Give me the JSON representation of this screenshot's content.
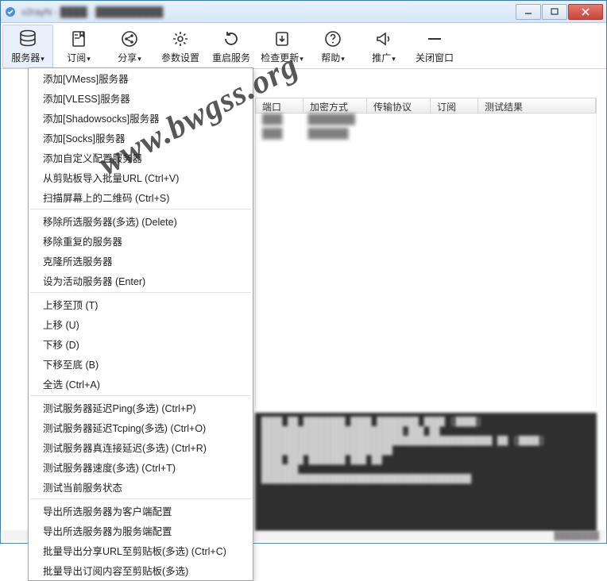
{
  "window": {
    "title_prefix": "v2rayN - ",
    "title_blur": "████ · ██████████"
  },
  "toolbar": {
    "items": [
      {
        "label": "服务器",
        "icon": "server-icon",
        "dropdown": true
      },
      {
        "label": "订阅",
        "icon": "subscribe-icon",
        "dropdown": true
      },
      {
        "label": "分享",
        "icon": "share-icon",
        "dropdown": true
      },
      {
        "label": "参数设置",
        "icon": "settings-icon",
        "dropdown": false
      },
      {
        "label": "重启服务",
        "icon": "restart-icon",
        "dropdown": false
      },
      {
        "label": "检查更新",
        "icon": "update-icon",
        "dropdown": true
      },
      {
        "label": "帮助",
        "icon": "help-icon",
        "dropdown": true
      },
      {
        "label": "推广",
        "icon": "promo-icon",
        "dropdown": true
      },
      {
        "label": "关闭窗口",
        "icon": "close-icon",
        "dropdown": false
      }
    ]
  },
  "menu": {
    "groups": [
      [
        "添加[VMess]服务器",
        "添加[VLESS]服务器",
        "添加[Shadowsocks]服务器",
        "添加[Socks]服务器",
        "添加自定义配置服务器",
        "从剪贴板导入批量URL (Ctrl+V)",
        "扫描屏幕上的二维码 (Ctrl+S)"
      ],
      [
        "移除所选服务器(多选) (Delete)",
        "移除重复的服务器",
        "克隆所选服务器",
        "设为活动服务器 (Enter)"
      ],
      [
        "上移至顶 (T)",
        "上移 (U)",
        "下移 (D)",
        "下移至底 (B)",
        "全选 (Ctrl+A)"
      ],
      [
        "测试服务器延迟Ping(多选) (Ctrl+P)",
        "测试服务器延迟Tcping(多选) (Ctrl+O)",
        "测试服务器真连接延迟(多选) (Ctrl+R)",
        "测试服务器速度(多选) (Ctrl+T)",
        "测试当前服务状态"
      ],
      [
        "导出所选服务器为客户端配置",
        "导出所选服务器为服务端配置",
        "批量导出分享URL至剪贴板(多选) (Ctrl+C)",
        "批量导出订阅内容至剪贴板(多选)"
      ]
    ]
  },
  "table": {
    "headers": [
      "端口",
      "加密方式",
      "传输协议",
      "订阅",
      "测试结果"
    ],
    "rows": [
      [
        "███",
        "███████",
        "",
        "",
        ""
      ],
      [
        "███",
        "██████",
        "",
        "",
        ""
      ]
    ]
  },
  "console": {
    "lines": [
      "████ ██ ████████ ████ ████████ ████ [████]",
      "███████████████████████████.███ ██",
      "████████████████████████████████████████████ ██ [████]",
      "",
      "█████████████████████████",
      "████ ███ ███████ ███ ██",
      "",
      "███████",
      "████████████████████████████████████████"
    ]
  },
  "watermark": "www.bwgss.org",
  "status": "████████"
}
